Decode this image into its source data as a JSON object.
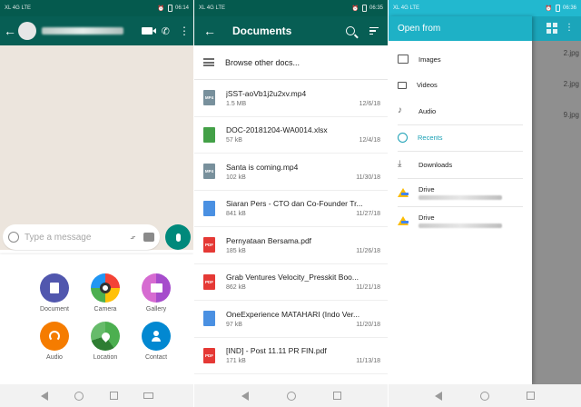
{
  "screen1": {
    "status": {
      "carrier": "XL 4G LTE",
      "time": "06:14"
    },
    "compose_placeholder": "Type a message",
    "attachments": [
      {
        "label": "Document",
        "icon": "document-icon",
        "color": "#5157ae"
      },
      {
        "label": "Camera",
        "icon": "camera-icon",
        "color": "#e53935"
      },
      {
        "label": "Gallery",
        "icon": "gallery-icon",
        "color": "#ac44cf"
      },
      {
        "label": "Audio",
        "icon": "headphones-icon",
        "color": "#f57c00"
      },
      {
        "label": "Location",
        "icon": "location-pin-icon",
        "color": "#2e7d32"
      },
      {
        "label": "Contact",
        "icon": "person-icon",
        "color": "#0288d1"
      }
    ],
    "colors": {
      "header": "#075e54",
      "mic": "#00897b"
    }
  },
  "screen2": {
    "status": {
      "carrier": "XL 4G LTE",
      "time": "06:35"
    },
    "title": "Documents",
    "browse_label": "Browse other docs...",
    "documents": [
      {
        "name": "jSST-aoVb1j2u2xv.mp4",
        "size": "1.5 MB",
        "date": "12/6/18",
        "type": "MP4",
        "color": "#78909c"
      },
      {
        "name": "DOC-20181204-WA0014.xlsx",
        "size": "57 kB",
        "date": "12/4/18",
        "type": "XLS",
        "color": "#43a047"
      },
      {
        "name": "Santa is coming.mp4",
        "size": "102 kB",
        "date": "11/30/18",
        "type": "MP4",
        "color": "#78909c"
      },
      {
        "name": "Siaran Pers - CTO dan Co-Founder Tr...",
        "size": "841 kB",
        "date": "11/27/18",
        "type": "DOC",
        "color": "#4a90e2"
      },
      {
        "name": "Pernyataan Bersama.pdf",
        "size": "185 kB",
        "date": "11/26/18",
        "type": "PDF",
        "color": "#e53935"
      },
      {
        "name": "Grab Ventures Velocity_Presskit Boo...",
        "size": "862 kB",
        "date": "11/21/18",
        "type": "PDF",
        "color": "#e53935"
      },
      {
        "name": "OneExperience MATAHARI (Indo Ver...",
        "size": "97 kB",
        "date": "11/20/18",
        "type": "DOC",
        "color": "#4a90e2"
      },
      {
        "name": "[IND] - Post 11.11 PR FIN.pdf",
        "size": "171 kB",
        "date": "11/13/18",
        "type": "PDF",
        "color": "#e53935"
      }
    ]
  },
  "screen3": {
    "status": {
      "carrier": "XL 4G LTE",
      "time": "06:36"
    },
    "title": "Open from",
    "items": [
      {
        "label": "Images",
        "icon": "image-icon",
        "active": false
      },
      {
        "label": "Videos",
        "icon": "video-icon",
        "active": false
      },
      {
        "label": "Audio",
        "icon": "music-note-icon",
        "active": false
      },
      {
        "label": "Recents",
        "icon": "clock-icon",
        "active": true
      },
      {
        "label": "Downloads",
        "icon": "download-icon",
        "active": false
      }
    ],
    "drives": [
      {
        "label": "Drive"
      },
      {
        "label": "Drive"
      }
    ],
    "background_files": [
      "2.jpg",
      "2.jpg",
      "9.jpg"
    ],
    "colors": {
      "accent": "#1eb1c6"
    }
  }
}
